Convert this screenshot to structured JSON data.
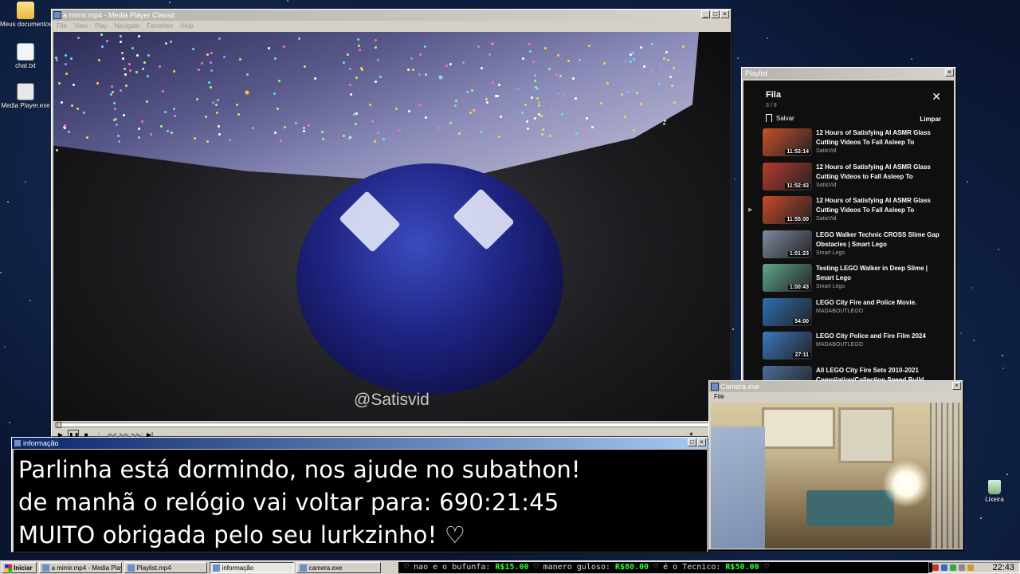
{
  "desktop": {
    "icons": [
      {
        "label": "Meus documentos",
        "icon": "folder-icon"
      },
      {
        "label": "chat.txt",
        "icon": "text-file-icon"
      },
      {
        "label": "Media Player.exe",
        "icon": "media-player-icon"
      },
      {
        "label": "Lixeira",
        "icon": "recycle-bin-icon"
      }
    ]
  },
  "mpc": {
    "title": "a mimir.mp4 - Media Player Classic",
    "menu": [
      "File",
      "View",
      "Play",
      "Navigate",
      "Favorites",
      "Help"
    ],
    "watermark": "@Satisvid"
  },
  "playlist": {
    "window_title": "Playlist",
    "title": "Fila",
    "count": "3 / 9",
    "save_label": "Salvar",
    "clear_label": "Limpar",
    "items": [
      {
        "title": "12 Hours of Satisfying AI ASMR Glass Cutting Videos To Fall Asleep To",
        "channel": "SatisVid",
        "duration": "11:53:14",
        "color": "#c8502a",
        "current": false
      },
      {
        "title": "12 Hours of Satisfying AI ASMR Glass Cutting Videos to Fall Asleep To",
        "channel": "SatisVid",
        "duration": "11:52:43",
        "color": "#b83a2e",
        "current": false
      },
      {
        "title": "12 Hours of Satisfying AI ASMR Glass Cutting Videos To Fall Asleep To",
        "channel": "SatisVid",
        "duration": "11:55:00",
        "color": "#c74a28",
        "current": true
      },
      {
        "title": "LEGO Walker Technic CROSS Slime Gap Obstacles | Smart Lego",
        "channel": "Smart Lego",
        "duration": "1:01:23",
        "color": "#7e8aa0",
        "current": false
      },
      {
        "title": "Testing LEGO Walker in Deep Slime | Smart Lego",
        "channel": "Smart Lego",
        "duration": "1:00:43",
        "color": "#5fa58c",
        "current": false
      },
      {
        "title": "LEGO City Fire and Police Movie.",
        "channel": "MADABOUTLEGO",
        "duration": "54:00",
        "color": "#2c6fb3",
        "current": false
      },
      {
        "title": "LEGO City Police and Fire Film 2024",
        "channel": "MADABOUTLEGO",
        "duration": "27:11",
        "color": "#3b78c0",
        "current": false
      },
      {
        "title": "All LEGO City Fire Sets 2010-2021 Compilation/Collection Speed Build",
        "channel": "",
        "duration": "",
        "color": "#4a6d9a",
        "current": false
      }
    ]
  },
  "info": {
    "title": "informação",
    "lines": [
      "Parlinha está dormindo, nos ajude no subathon!",
      "de manhã o relógio vai voltar para:  690:21:45",
      "MUITO obrigada pelo seu lurkzinho! ♡"
    ]
  },
  "camera": {
    "title": "Camera.exe",
    "menu_file": "File"
  },
  "taskbar": {
    "start_label": "Iniciar",
    "tasks": [
      "a mimir.mp4 - Media Playe...",
      "Playlist.mp4",
      "informação",
      "camera.exe"
    ],
    "active_task_index": 2,
    "ticker": [
      {
        "text": "♡ nao e o bufunfa: ",
        "money": "R$15.00"
      },
      {
        "text": " ♡ manero guloso: ",
        "money": "R$80.00"
      },
      {
        "text": " ♡ é o Tecnico: ",
        "money": "R$50.00"
      },
      {
        "text": " ♡",
        "money": ""
      }
    ],
    "clock": "22:43"
  }
}
